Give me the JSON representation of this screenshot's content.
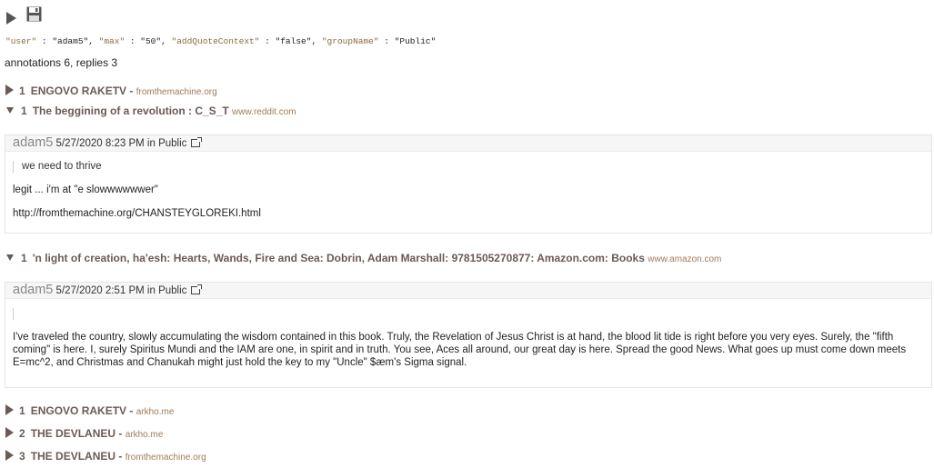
{
  "params": {
    "user_key": "\"user\"",
    "user_val": "\"adam5\"",
    "max_key": "\"max\"",
    "max_val": "\"50\"",
    "aqc_key": "\"addQuoteContext\"",
    "aqc_val": "\"false\"",
    "group_key": "\"groupName\"",
    "group_val": "\"Public\""
  },
  "counts": "annotations 6, replies 3",
  "threads": [
    {
      "count": "1",
      "title": "ENGOVO RAKETV -",
      "domain": "fromthemachine.org"
    },
    {
      "count": "1",
      "title": "The beggining of a revolution : C_S_T",
      "domain": "www.reddit.com"
    },
    {
      "count": "1",
      "title": "'n light of creation, ha'esh: Hearts, Wands, Fire and Sea: Dobrin, Adam Marshall: 9781505270877: Amazon.com: Books",
      "domain": "www.amazon.com"
    },
    {
      "count": "1",
      "title": "ENGOVO RAKETV -",
      "domain": "arkho.me"
    },
    {
      "count": "2",
      "title": "THE DEVLANEU -",
      "domain": "arkho.me"
    },
    {
      "count": "3",
      "title": "THE DEVLANEU -",
      "domain": "fromthemachine.org"
    }
  ],
  "annotations": [
    {
      "user": "adam5",
      "meta": "5/27/2020 8:23 PM in Public",
      "quote": "we need to thrive",
      "paragraphs": [
        "legit ... i'm at \"e slowwwwwwer\"",
        "http://fromthemachine.org/CHANSTEYGLOREKI.html"
      ]
    },
    {
      "user": "adam5",
      "meta": "5/27/2020 2:51 PM in Public",
      "quote": "",
      "paragraphs": [
        "I've traveled the country, slowly accumulating the wisdom contained in this book. Truly, the Revelation of Jesus Christ is at hand, the blood lit tide is right before you very eyes. Surely, the \"fifth coming\" is here. I, surely Spiritus Mundi and the IAM are one, in spirit and in truth. You see, Aces all around, our great day is here. Spread the good News. What goes up must come down meets E=mc^2, and Christmas and Chanukah might just hold the key to my \"Uncle\" $æm's Sigma signal."
      ]
    }
  ]
}
